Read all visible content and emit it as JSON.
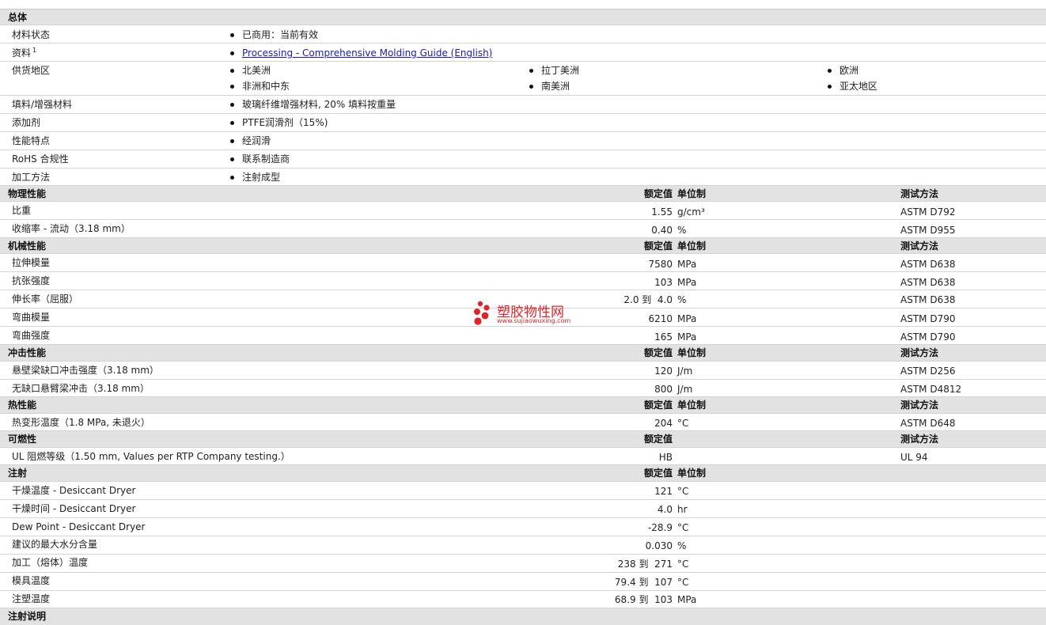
{
  "general": {
    "title": "总体",
    "material_status_label": "材料状态",
    "material_status_value": "已商用：当前有效",
    "docs_label": "资料",
    "docs_sup": "1",
    "docs_link": "Processing - Comprehensive Molding Guide (English)",
    "supply_label": "供货地区",
    "supply_regions": [
      "北美洲",
      "拉丁美洲",
      "欧洲",
      "非洲和中东",
      "南美洲",
      "亚太地区"
    ],
    "filler_label": "填料/增强材料",
    "filler_value": "玻璃纤维增强材料, 20% 填料按重量",
    "additive_label": "添加剂",
    "additive_value": "PTFE润滑剂（15%)",
    "features_label": "性能特点",
    "features_value": "经润滑",
    "rohs_label": "RoHS 合规性",
    "rohs_value": "联系制造商",
    "process_label": "加工方法",
    "process_value": "注射成型"
  },
  "columns": {
    "nominal": "额定值",
    "unit": "单位制",
    "test": "测试方法"
  },
  "physical": {
    "title": "物理性能",
    "rows": [
      {
        "label": "比重",
        "value": "1.55",
        "unit": "g/cm³",
        "test": "ASTM D792"
      },
      {
        "label": "收缩率 - 流动（3.18 mm）",
        "value": "0.40",
        "unit": "%",
        "test": "ASTM D955"
      }
    ]
  },
  "mechanical": {
    "title": "机械性能",
    "rows": [
      {
        "label": "拉伸模量",
        "value": "7580",
        "unit": "MPa",
        "test": "ASTM D638"
      },
      {
        "label": "抗张强度",
        "value": "103",
        "unit": "MPa",
        "test": "ASTM D638"
      },
      {
        "label": "伸长率（屈服）",
        "value": "2.0 到  4.0",
        "unit": "%",
        "test": "ASTM D638"
      },
      {
        "label": "弯曲模量",
        "value": "6210",
        "unit": "MPa",
        "test": "ASTM D790"
      },
      {
        "label": "弯曲强度",
        "value": "165",
        "unit": "MPa",
        "test": "ASTM D790"
      }
    ]
  },
  "impact": {
    "title": "冲击性能",
    "rows": [
      {
        "label": "悬壁梁缺口冲击强度（3.18 mm）",
        "value": "120",
        "unit": "J/m",
        "test": "ASTM D256"
      },
      {
        "label": "无缺口悬臂梁冲击（3.18 mm）",
        "value": "800",
        "unit": "J/m",
        "test": "ASTM D4812"
      }
    ]
  },
  "thermal": {
    "title": "热性能",
    "rows": [
      {
        "label": "热变形温度（1.8 MPa, 未退火）",
        "value": "204",
        "unit": "°C",
        "test": "ASTM D648"
      }
    ]
  },
  "flammability": {
    "title": "可燃性",
    "rows": [
      {
        "label": "UL 阻燃等级（1.50 mm, Values per RTP Company testing.）",
        "value": "HB",
        "unit": "",
        "test": "UL 94"
      }
    ]
  },
  "injection": {
    "title": "注射",
    "rows": [
      {
        "label": "干燥温度 - Desiccant Dryer",
        "value": "121",
        "unit": "°C"
      },
      {
        "label": "干燥时间 - Desiccant Dryer",
        "value": "4.0",
        "unit": "hr"
      },
      {
        "label": "Dew Point - Desiccant Dryer",
        "value": "-28.9",
        "unit": "°C"
      },
      {
        "label": "建议的最大水分含量",
        "value": "0.030",
        "unit": "%"
      },
      {
        "label": "加工（熔体）温度",
        "value": "238 到  271",
        "unit": "°C"
      },
      {
        "label": "模具温度",
        "value": "79.4 到  107",
        "unit": "°C"
      },
      {
        "label": "注塑温度",
        "value": "68.9 到  103",
        "unit": "MPa"
      }
    ]
  },
  "injection_notes": {
    "title": "注射说明"
  },
  "watermark": {
    "title": "塑胶物性网",
    "url": "www.sujiaowuxing.com",
    "color": "#e0242a"
  }
}
